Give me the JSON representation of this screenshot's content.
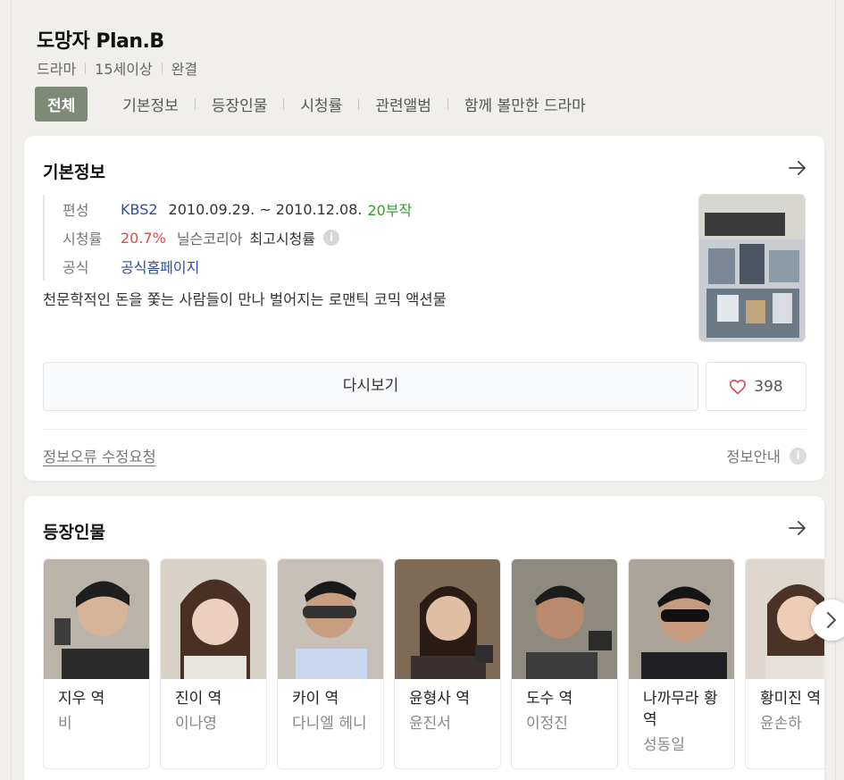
{
  "header": {
    "title": "도망자 Plan.B",
    "meta": [
      "드라마",
      "15세이상",
      "완결"
    ]
  },
  "tabs": [
    {
      "label": "전체",
      "active": true
    },
    {
      "label": "기본정보"
    },
    {
      "label": "등장인물"
    },
    {
      "label": "시청률"
    },
    {
      "label": "관련앨범"
    },
    {
      "label": "함께 볼만한 드라마"
    }
  ],
  "basic_info": {
    "heading": "기본정보",
    "broadcast_key": "편성",
    "channel": "KBS2",
    "dates": "2010.09.29. ~ 2010.12.08.",
    "episodes": "20부작",
    "rating_key": "시청률",
    "rating_value": "20.7%",
    "rating_source": "닐슨코리아",
    "rating_label": "최고시청률",
    "official_key": "공식",
    "official_link": "공식홈페이지",
    "description": "천문학적인 돈을 쫓는 사람들이 만나 벌어지는 로맨틱 코믹 액션물",
    "rewatch_button": "다시보기",
    "like_count": "398",
    "report_link": "정보오류 수정요청",
    "guide_link": "정보안내",
    "info_icon": "i"
  },
  "cast_section": {
    "heading": "등장인물",
    "members": [
      {
        "role": "지우 역",
        "actor": "비"
      },
      {
        "role": "진이 역",
        "actor": "이나영"
      },
      {
        "role": "카이 역",
        "actor": "다니엘 헤니"
      },
      {
        "role": "윤형사 역",
        "actor": "윤진서"
      },
      {
        "role": "도수 역",
        "actor": "이정진"
      },
      {
        "role": "나까무라 황 역",
        "actor": "성동일"
      },
      {
        "role": "황미진 역",
        "actor": "윤손하"
      }
    ]
  },
  "colors": {
    "background": "#f0efeb",
    "active_tab": "#7d8a75",
    "link_blue": "#2d4da3",
    "rating_red": "#e04747",
    "episodes_green": "#2ca02c"
  }
}
